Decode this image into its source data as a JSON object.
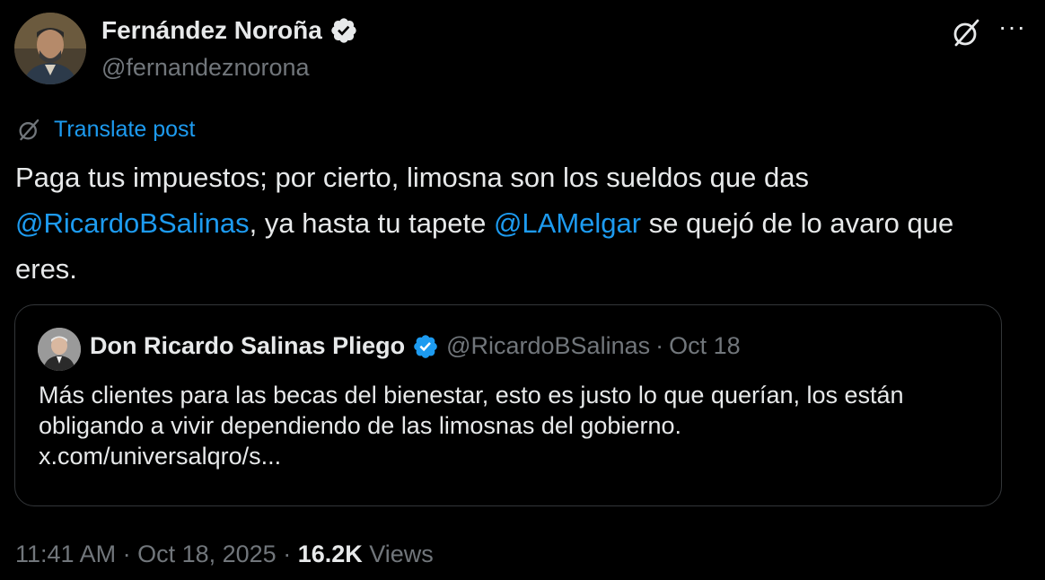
{
  "author": {
    "name": "Fernández Noroña",
    "handle": "@fernandeznorona"
  },
  "top_actions": {
    "grok_icon": "grok-icon",
    "more_label": "···"
  },
  "translate": {
    "label": "Translate post"
  },
  "post": {
    "text_1": "Paga tus impuestos; por cierto, limosna son los sueldos que das ",
    "mention_1": "@RicardoBSalinas",
    "text_2": ", ya hasta tu tapete ",
    "mention_2": "@LAMelgar",
    "text_3": " se quejó de lo avaro que eres."
  },
  "quoted": {
    "name": "Don Ricardo Salinas Pliego",
    "handle": "@RicardoBSalinas",
    "separator": "·",
    "date": "Oct 18",
    "text": "Más clientes para las becas del bienestar, esto es justo lo que querían, los están obligando a vivir dependiendo de las limosnas del gobierno.",
    "link": "x.com/universalqro/s..."
  },
  "meta": {
    "time": "11:41 AM",
    "separator": " · ",
    "date": "Oct 18, 2025",
    "views_count": "16.2K",
    "views_label": "Views"
  },
  "colors": {
    "background": "#000000",
    "text": "#e7e9ea",
    "secondary": "#71767b",
    "accent": "#1d9bf0"
  }
}
